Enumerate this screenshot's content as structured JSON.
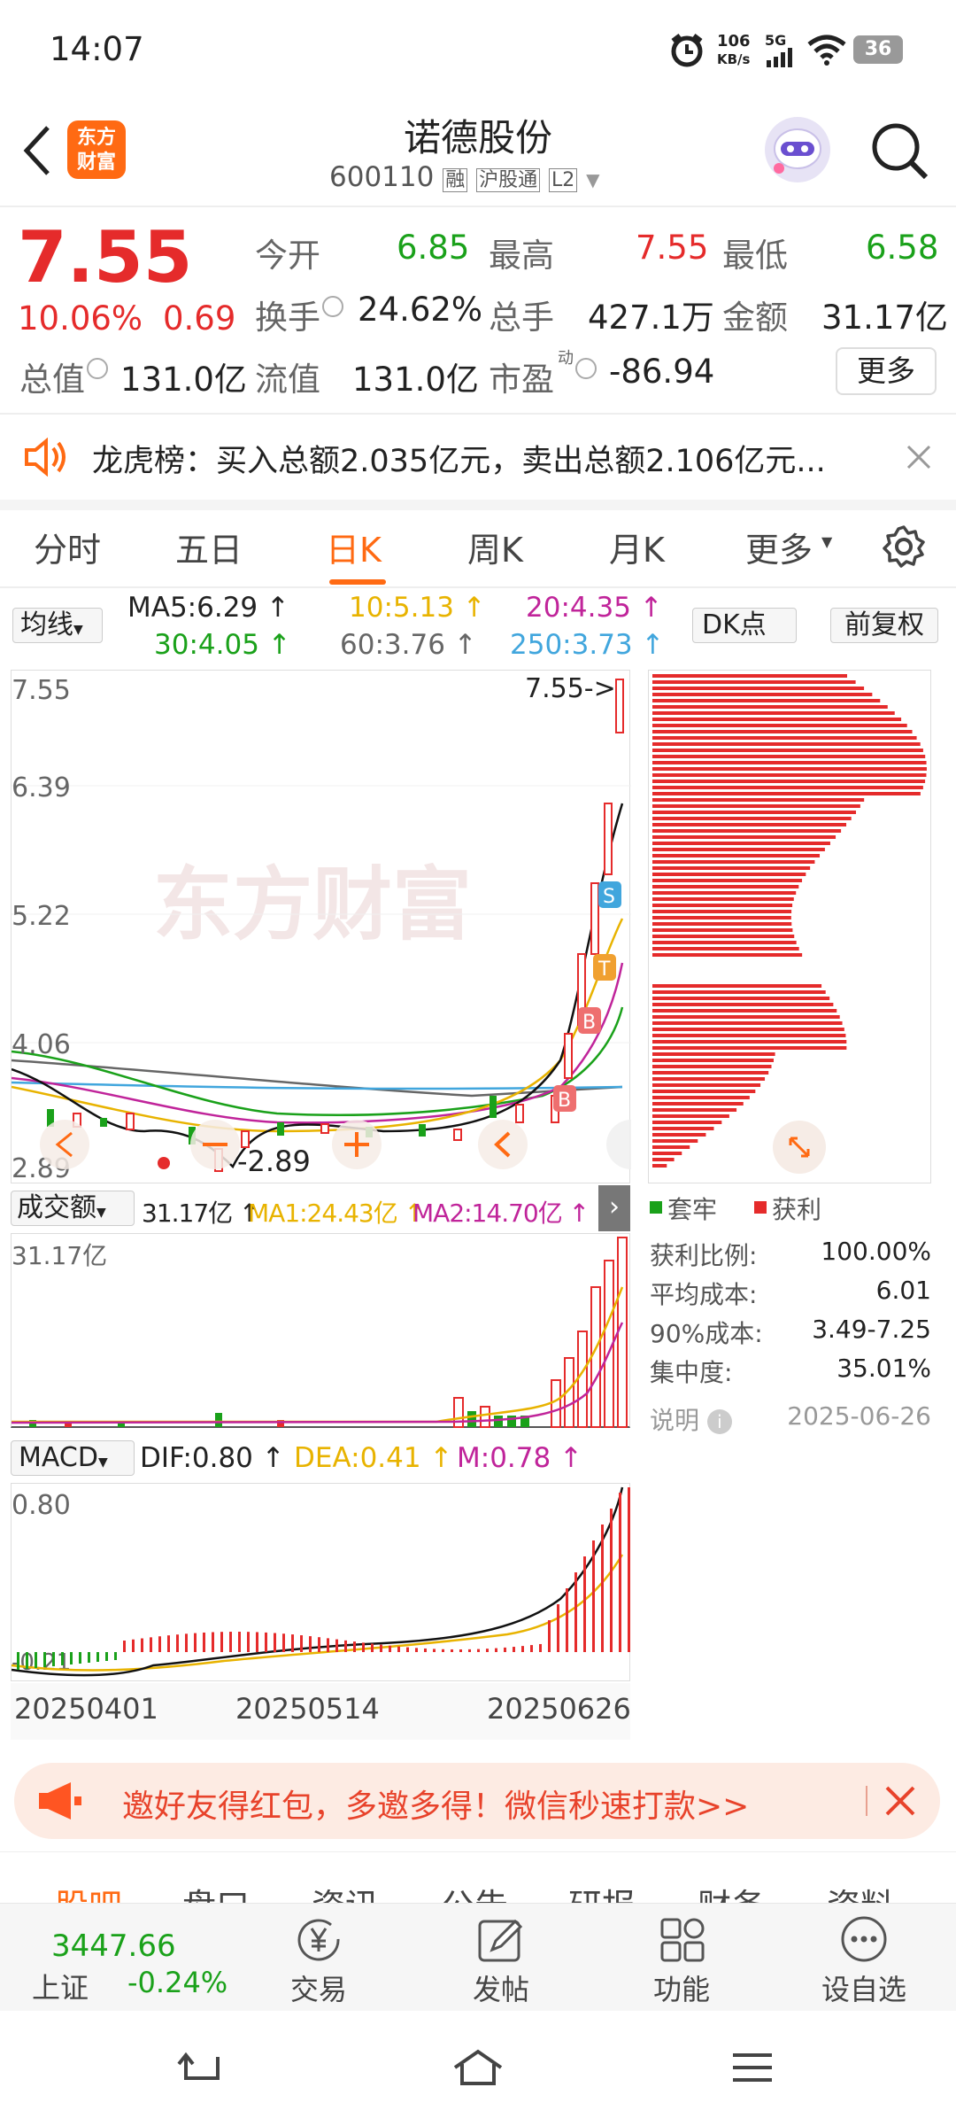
{
  "status_bar": {
    "time": "14:07",
    "net_speed": "106",
    "net_unit": "KB/s",
    "signal": "5G",
    "battery": "36"
  },
  "header": {
    "logo_text_1": "东方",
    "logo_text_2": "财富",
    "title": "诺德股份",
    "code": "600110",
    "tag_rong": "融",
    "tag_hgt": "沪股通",
    "tag_l2": "L2"
  },
  "quote": {
    "price": "7.55",
    "change_pct": "10.06%",
    "change": "0.69",
    "open_label": "今开",
    "open": "6.85",
    "high_label": "最高",
    "high": "7.55",
    "low_label": "最低",
    "low": "6.58",
    "turnover_label": "换手",
    "turnover": "24.62%",
    "volume_label": "总手",
    "volume": "427.1万",
    "amount_label": "金额",
    "amount": "31.17亿",
    "mcap_label": "总值",
    "mcap": "131.0亿",
    "float_label": "流值",
    "float": "131.0亿",
    "pe_label": "市盈",
    "pe_sup": "动",
    "pe": "-86.94",
    "more": "更多"
  },
  "notice": {
    "text": "龙虎榜：买入总额2.035亿元，卖出总额2.106亿元..."
  },
  "tabs": [
    {
      "label": "分时"
    },
    {
      "label": "五日"
    },
    {
      "label": "日K"
    },
    {
      "label": "周K"
    },
    {
      "label": "月K"
    },
    {
      "label": "更多"
    }
  ],
  "ma": {
    "selector": "均线",
    "ma5": "MA5:6.29 ↑",
    "ma10": "10:5.13 ↑",
    "ma20": "20:4.35 ↑",
    "ma30": "30:4.05 ↑",
    "ma60": "60:3.76 ↑",
    "ma250": "250:3.73 ↑",
    "dk": "DK点",
    "fq": "前复权"
  },
  "kline": {
    "y_labels": [
      "7.55",
      "6.39",
      "5.22",
      "4.06",
      "2.89"
    ],
    "max_label": "7.55->",
    "min_label": "-2.89",
    "watermark": "东方财富",
    "markers": {
      "s": "S",
      "t": "T",
      "b": "B"
    }
  },
  "chips": {
    "legend_trapped": "套牢",
    "legend_profit": "获利",
    "rows": [
      {
        "label": "获利比例:",
        "value": "100.00%"
      },
      {
        "label": "平均成本:",
        "value": "6.01"
      },
      {
        "label": "90%成本:",
        "value": "3.49-7.25"
      },
      {
        "label": "集中度:",
        "value": "35.01%"
      }
    ],
    "note": "说明",
    "date": "2025-06-26"
  },
  "volume": {
    "selector": "成交额",
    "v": "31.17亿 ↑",
    "ma1": "MA1:24.43亿 ↑",
    "ma2": "MA2:14.70亿 ↑",
    "ylabel": "31.17亿"
  },
  "macd": {
    "selector": "MACD",
    "dif": "DIF:0.80 ↑",
    "dea": "DEA:0.41 ↑",
    "m": "M:0.78 ↑",
    "ytop": "0.80",
    "ybot": "-0.21"
  },
  "dates": [
    "20250401",
    "20250514",
    "20250626"
  ],
  "banner": {
    "text": "邀好友得红包，多邀多得！微信秒速打款>>"
  },
  "sub_tabs": [
    "股吧",
    "盘口",
    "资讯",
    "公告",
    "研报",
    "财务",
    "资料"
  ],
  "bottom": {
    "index_value": "3447.66",
    "index_name": "上证",
    "index_change": "-0.24%",
    "items": [
      {
        "label": "交易"
      },
      {
        "label": "发帖"
      },
      {
        "label": "功能"
      },
      {
        "label": "设自选"
      }
    ]
  },
  "colors": {
    "up": "#e52b2b",
    "down": "#1aa11a",
    "accent": "#ff6a13"
  }
}
